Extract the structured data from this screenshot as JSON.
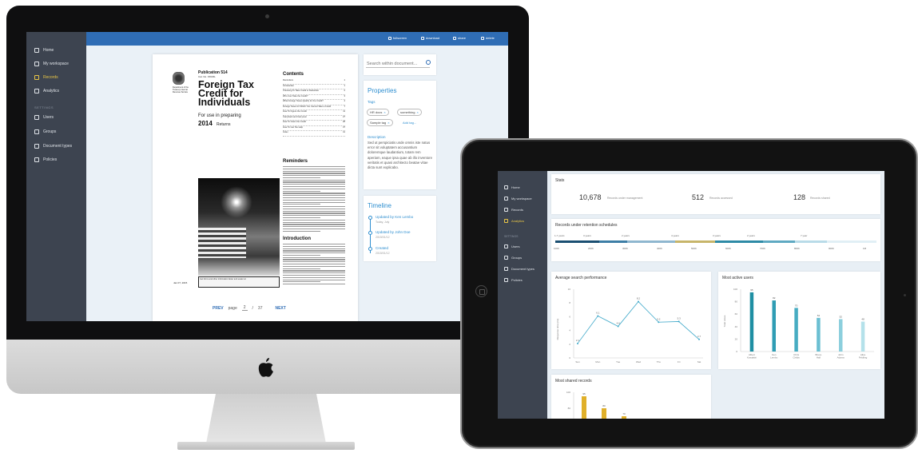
{
  "desktop": {
    "nav": [
      {
        "label": "Home",
        "icon": "home-icon"
      },
      {
        "label": "My workspace",
        "icon": "workspace-icon"
      },
      {
        "label": "Records",
        "icon": "folder-icon"
      },
      {
        "label": "Analytics",
        "icon": "analytics-icon"
      }
    ],
    "settings_title": "SETTINGS",
    "settings": [
      {
        "label": "Users",
        "icon": "users-icon"
      },
      {
        "label": "Groups",
        "icon": "groups-icon"
      },
      {
        "label": "Document types",
        "icon": "document-types-icon"
      },
      {
        "label": "Policies",
        "icon": "policies-icon"
      }
    ],
    "toolbar": {
      "fullscreen": "fullscreen",
      "download": "download",
      "share": "share",
      "delete": "delete"
    },
    "doc": {
      "pub": "Publication 514",
      "pub_sub": "Cat. No. 15023L",
      "dept": "Department of the Treasury Internal Revenue Service",
      "title": "Foreign Tax Credit for Individuals",
      "for_use": "For use in preparing",
      "year": "2014",
      "returns": "Returns",
      "contents_title": "Contents",
      "toc": [
        {
          "t": "Reminders",
          "p": "1"
        },
        {
          "t": "Introduction",
          "p": "1"
        },
        {
          "t": "Choosing To Take Credit or Deduction",
          "p": "2"
        },
        {
          "t": "Who Can Take the Credit?",
          "p": "3"
        },
        {
          "t": "What Foreign Taxes Qualify for the Credit?",
          "p": "4"
        },
        {
          "t": "Foreign Taxes for Which You Cannot Take a Credit",
          "p": "7"
        },
        {
          "t": "How To Figure the Credit",
          "p": "11"
        },
        {
          "t": "Carryback and Carryover",
          "p": "27"
        },
        {
          "t": "How To Claim the Credit",
          "p": "28"
        },
        {
          "t": "How To Get Tax Help",
          "p": "37"
        },
        {
          "t": "Index",
          "p": "41"
        }
      ],
      "reminders_title": "Reminders",
      "introduction_title": "Introduction",
      "caption": "Get forms and other information faster and easier at:",
      "date": "Jan 07, 2015"
    },
    "pager": {
      "prev": "PREV",
      "page_label": "page",
      "current": "2",
      "separator": "/",
      "total": "37",
      "next": "NEXT"
    },
    "search_placeholder": "Search within document...",
    "properties": {
      "title": "Properties",
      "tags_label": "Tags",
      "tags": [
        "HR docs",
        "something",
        "Sample tag"
      ],
      "add_tag": "Add tag...",
      "description_label": "Description",
      "description": "Sed ut perspiciatis unde omnis iste natus error sit voluptatem accusantium doloremque laudantium, totam rem aperiam, eaque ipsa quae ab illo inventore veritatis et quasi architecto beatae vitae dicta sunt explicabo."
    },
    "timeline": {
      "title": "Timeline",
      "events": [
        {
          "title": "Updated by Ken Lembo",
          "date": "Today, July"
        },
        {
          "title": "Updated by John Doe",
          "date": "2015/01/12"
        },
        {
          "title": "Created",
          "date": "2015/01/12"
        }
      ]
    }
  },
  "tablet": {
    "nav": [
      {
        "label": "Home"
      },
      {
        "label": "My workspace"
      },
      {
        "label": "Records"
      },
      {
        "label": "Analytics"
      }
    ],
    "settings_title": "SETTINGS",
    "settings": [
      {
        "label": "Users"
      },
      {
        "label": "Groups"
      },
      {
        "label": "Document types"
      },
      {
        "label": "Policies"
      }
    ],
    "stats": {
      "title": "Stats",
      "items": [
        {
          "value": "10,678",
          "label": "Records under management"
        },
        {
          "value": "512",
          "label": "Records accessed"
        },
        {
          "value": "128",
          "label": "Records shared"
        }
      ]
    },
    "retention": {
      "title": "Records under retention schedules",
      "years": [
        "1-7 years",
        "3 years",
        "2 years",
        "4 years",
        "3 years",
        "2 years",
        "7 year"
      ],
      "segment_colors": [
        "#1b4f72",
        "#3d7ea6",
        "#8fb7cf",
        "#c7b56a",
        "#2e8aa6",
        "#5fa9c2",
        "#b9dbe8",
        "#e1eff5"
      ],
      "ticks": [
        "100K",
        "200K",
        "300K",
        "400K",
        "500K",
        "600K",
        "700K",
        "800K",
        "900K",
        "1M"
      ]
    },
    "charts": {
      "search_title": "Average search performance",
      "active_title": "Most active users",
      "shared_title": "Most shared records"
    }
  },
  "chart_data": [
    {
      "type": "line",
      "title": "Average search performance",
      "ylabel": "Response time (ms)",
      "categories": [
        "Sun",
        "Mon",
        "Tue",
        "Wed",
        "Thu",
        "Fri",
        "Sat"
      ],
      "values": [
        2.1,
        6.1,
        4.6,
        8.2,
        5.2,
        5.3,
        2.7
      ],
      "ylim": [
        0,
        10
      ],
      "yticks": [
        0,
        2,
        4,
        6,
        8,
        10
      ],
      "color": "#3ea8c9"
    },
    {
      "type": "bar",
      "title": "Most active users",
      "ylabel": "Total views",
      "categories": [
        "Albert Kowalski",
        "Ken Lembo",
        "Chris Childs",
        "Bruce Hall",
        "John Adams",
        "Alice Feldling"
      ],
      "values": [
        95,
        82,
        70,
        54,
        52,
        48
      ],
      "ylim": [
        0,
        100
      ],
      "yticks": [
        0,
        20,
        40,
        60,
        80,
        100
      ],
      "colors": [
        "#1f8fa3",
        "#2f9db4",
        "#47acc2",
        "#6bbfd2",
        "#8ccfdd",
        "#b4e1ea"
      ]
    },
    {
      "type": "bar",
      "title": "Most shared records",
      "values": [
        95,
        80,
        70
      ],
      "ylim": [
        0,
        100
      ],
      "yticks": [
        80,
        100
      ],
      "colors": [
        "#e0b02a",
        "#e0b02a",
        "#e0b02a"
      ]
    }
  ]
}
